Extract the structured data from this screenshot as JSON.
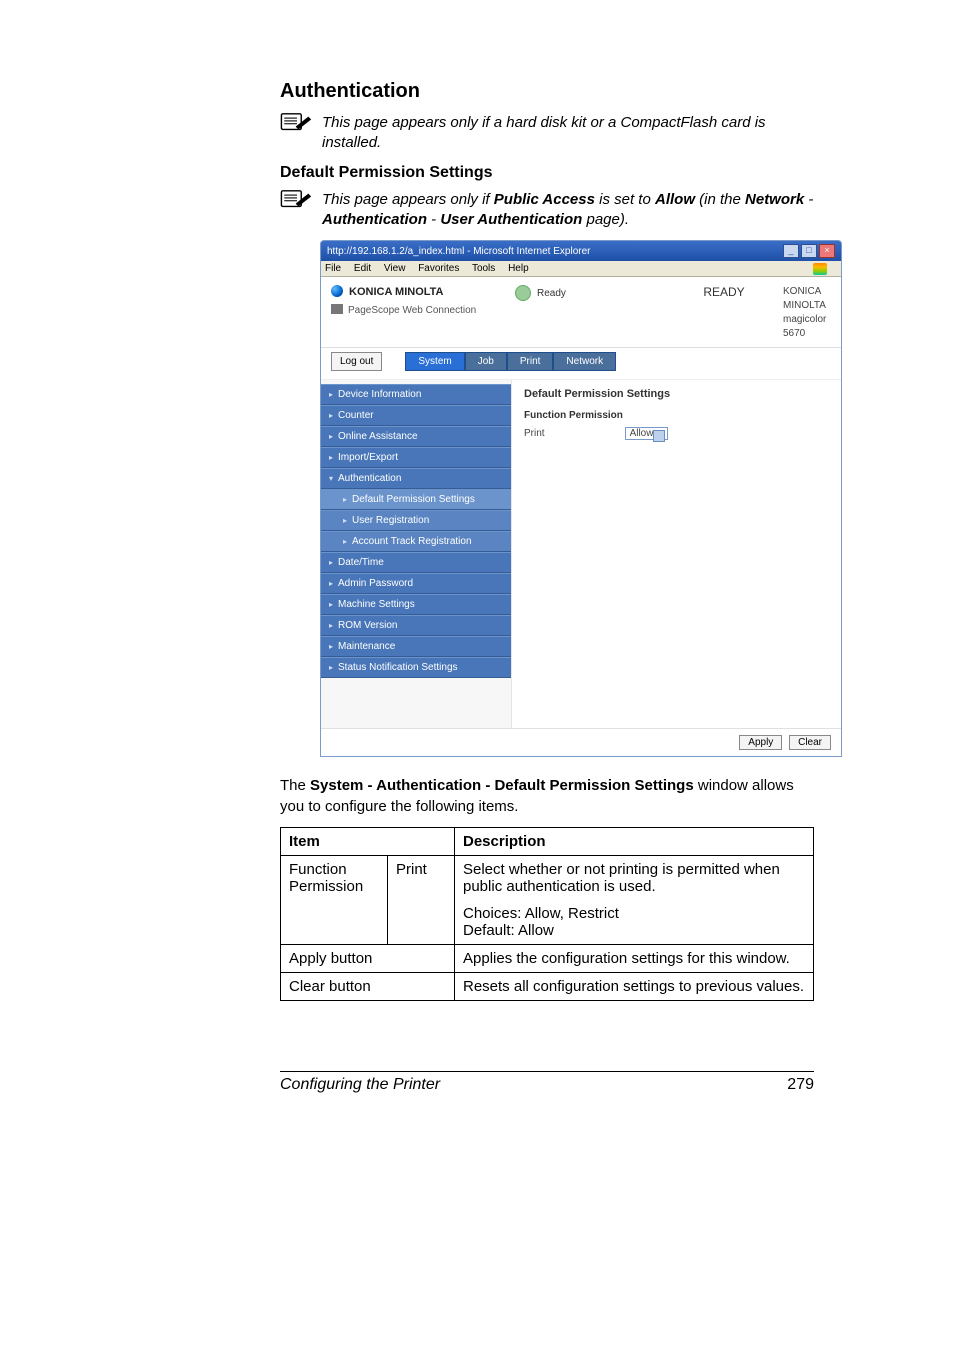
{
  "section": {
    "title": "Authentication"
  },
  "note1": "This page appears only if a hard disk kit or a CompactFlash card is installed.",
  "subhead": "Default Permission Settings",
  "note2_pre": "This page appears only if ",
  "note2_b1": "Public Access",
  "note2_mid1": " is set to ",
  "note2_b2": "Allow",
  "note2_mid2": " (in the ",
  "note2_b3": "Network",
  "note2_mid3": " - ",
  "note2_b4": "Authentication",
  "note2_mid4": " - ",
  "note2_b5": "User Authentication",
  "note2_end": " page).",
  "ie": {
    "title": "http://192.168.1.2/a_index.html - Microsoft Internet Explorer",
    "menus": [
      "File",
      "Edit",
      "View",
      "Favorites",
      "Tools",
      "Help"
    ],
    "brand1": "KONICA MINOLTA",
    "brand2": "PageScope Web Connection",
    "ready_small": "Ready",
    "ready_big": "READY",
    "dev_brand": "KONICA MINOLTA",
    "dev_model": "magicolor 5670",
    "logout": "Log out",
    "tabs": [
      "System",
      "Job",
      "Print",
      "Network"
    ],
    "side": [
      "Device Information",
      "Counter",
      "Online Assistance",
      "Import/Export",
      "Authentication",
      "Default Permission Settings",
      "User Registration",
      "Account Track Registration",
      "Date/Time",
      "Admin Password",
      "Machine Settings",
      "ROM Version",
      "Maintenance",
      "Status Notification Settings"
    ],
    "content_h": "Default Permission Settings",
    "content_sub": "Function Permission",
    "content_label": "Print",
    "content_select": "Allow",
    "btn_apply": "Apply",
    "btn_clear": "Clear"
  },
  "para_pre": "The ",
  "para_b": "System - Authentication - Default Permission Settings",
  "para_post": " window allows you to configure the following items.",
  "table": {
    "hdr_item": "Item",
    "hdr_desc": "Description",
    "r1c1": "Function Permission",
    "r1c2": "Print",
    "r1desc1": "Select whether or not printing is permitted when public authentication is used.",
    "r1desc2": "Choices: Allow, Restrict",
    "r1desc3": "Default:  Allow",
    "r2c1": "Apply button",
    "r2desc": "Applies the configuration settings for this window.",
    "r3c1": "Clear button",
    "r3desc": "Resets all configuration settings to previous values."
  },
  "footer": {
    "left": "Configuring the Printer",
    "right": "279"
  },
  "chart_data": {
    "type": "table"
  }
}
